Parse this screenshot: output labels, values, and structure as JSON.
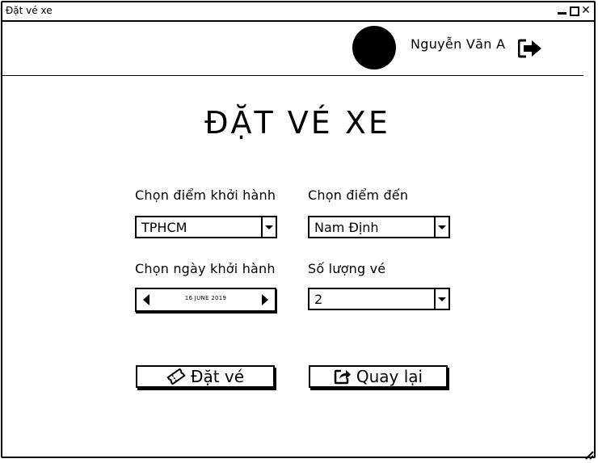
{
  "window": {
    "title": "Đặt vé xe"
  },
  "header": {
    "user_name": "Nguyễn Văn A"
  },
  "page": {
    "title": "ĐẶT VÉ XE"
  },
  "form": {
    "departure": {
      "label": "Chọn điểm khởi hành",
      "value": "TPHCM"
    },
    "destination": {
      "label": "Chọn điểm đến",
      "value": "Nam Định"
    },
    "date": {
      "label": "Chọn ngày khởi hành",
      "value": "16 JUNE 2019"
    },
    "quantity": {
      "label": "Số lượng vé",
      "value": "2"
    }
  },
  "actions": {
    "book_label": "Đặt vé",
    "back_label": "Quay lại"
  },
  "icons": {
    "logout": "sign-out-icon",
    "book": "ticket-icon",
    "back": "share-icon"
  }
}
